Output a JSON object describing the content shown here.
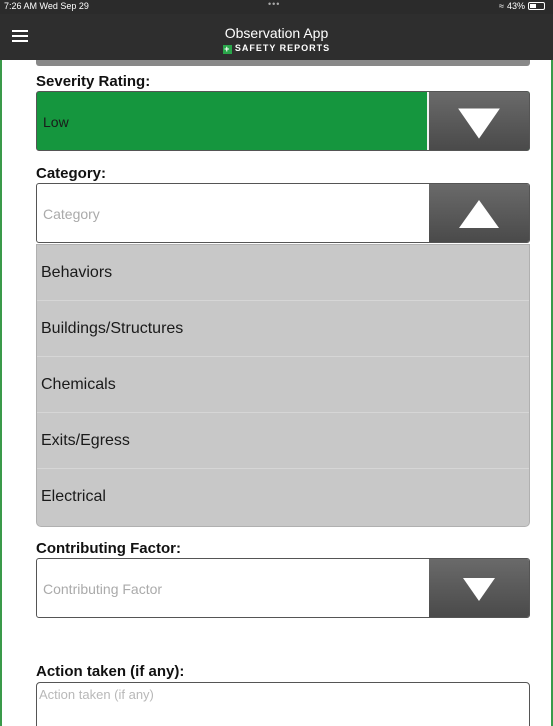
{
  "status_bar": {
    "time": "7:26 AM  Wed Sep 29",
    "dots": "•••",
    "wifi_icon": "wifi-icon",
    "battery": "43%"
  },
  "header": {
    "title": "Observation App",
    "subtitle": "SAFETY REPORTS",
    "plus_icon": "+",
    "menu_icon": "hamburger-icon",
    "accent_color": "#2aa64a"
  },
  "severity": {
    "label": "Severity Rating:",
    "value": "Low",
    "color": "#15963e"
  },
  "category": {
    "label": "Category:",
    "placeholder": "Category",
    "options": [
      "Behaviors",
      "Buildings/Structures",
      "Chemicals",
      "Exits/Egress",
      "Electrical"
    ]
  },
  "contributing": {
    "label": "Contributing Factor:",
    "placeholder": "Contributing Factor"
  },
  "action": {
    "label": "Action taken (if any):",
    "placeholder": "Action taken (if any)"
  }
}
